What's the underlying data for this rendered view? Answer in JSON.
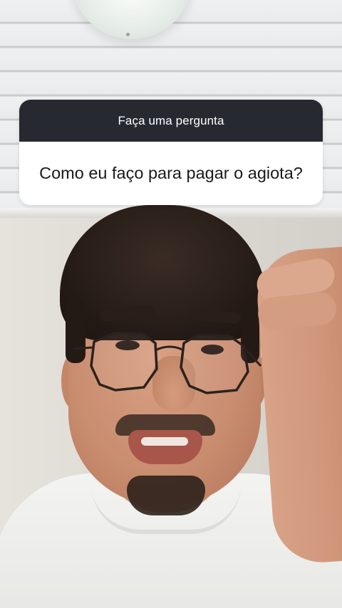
{
  "question_sticker": {
    "header_label": "Faça uma pergunta",
    "question_text": "Como eu faço para pagar o agiota?"
  },
  "colors": {
    "sticker_header_bg": "#262a30",
    "sticker_header_text": "#ffffff",
    "sticker_body_bg": "#ffffff",
    "sticker_body_text": "#1a1a1a"
  }
}
